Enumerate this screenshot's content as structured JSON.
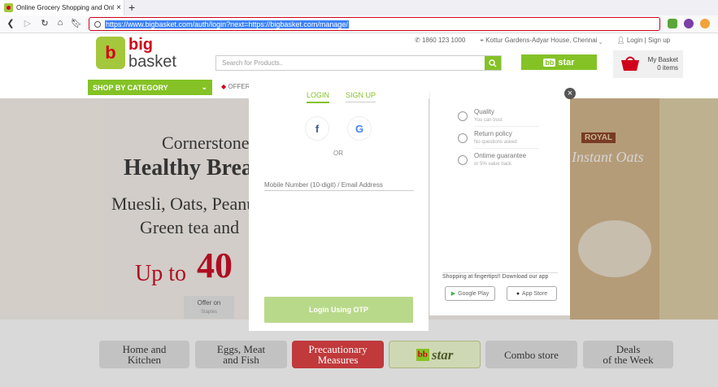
{
  "browser": {
    "tab_title": "Online Grocery Shopping and Onl",
    "tab_close": "×",
    "new_tab": "+",
    "url": "https://www.bigbasket.com/auth/login?next=https://bigbasket.com/manage/"
  },
  "header": {
    "logo_line1": "big",
    "logo_line2": "basket",
    "phone": "1860 123 1000",
    "location": "Kottur Gardens-Adyar House, Chennai",
    "login": "Login",
    "signup": "Sign up",
    "search_placeholder": "Search for Products..",
    "star_label": "star",
    "basket_title": "My Basket",
    "basket_count": "0 items",
    "shop_by_category": "SHOP BY CATEGORY",
    "offers": "OFFERS"
  },
  "banner": {
    "line1": "Cornerstone",
    "line2": "Healthy Breakfast",
    "line3": "Muesli, Oats, Peanut",
    "line4": "Green tea and",
    "offer_prefix": "Up to",
    "offer_value": "40",
    "offer_tab_title": "Offer on",
    "offer_tab_sub": "Staples",
    "brand": "ROYAL",
    "product_text": "Instant Oats"
  },
  "tiles": [
    {
      "label1": "Home and",
      "label2": "Kitchen"
    },
    {
      "label1": "Eggs, Meat",
      "label2": "and Fish"
    },
    {
      "label1": "Precautionary",
      "label2": "Measures"
    },
    {
      "label1": "star",
      "label2": ""
    },
    {
      "label1": "Combo store",
      "label2": ""
    },
    {
      "label1": "Deals",
      "label2": "of the Week"
    }
  ],
  "modal": {
    "tab_login": "LOGIN",
    "tab_signup": "SIGN UP",
    "facebook": "f",
    "google": "G",
    "or": "OR",
    "mobile_placeholder": "Mobile Number (10-digit) / Email Address",
    "otp_button": "Login Using OTP",
    "close": "×",
    "features": [
      {
        "title": "Quality",
        "sub": "You can trust"
      },
      {
        "title": "Return policy",
        "sub": "No questions asked"
      },
      {
        "title": "Ontime guarantee",
        "sub": "or 5% value back"
      }
    ],
    "download_text": "Shopping at fingertips!! Download our app",
    "google_play": "Google Play",
    "app_store": "App Store"
  },
  "colors": {
    "brand_green": "#84c225",
    "brand_red": "#d0021b"
  }
}
